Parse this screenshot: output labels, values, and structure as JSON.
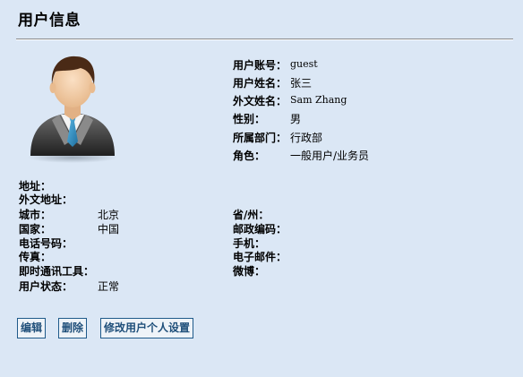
{
  "page": {
    "title": "用户信息"
  },
  "profile": [
    {
      "label": "用户账号：",
      "value": "guest"
    },
    {
      "label": "用户姓名：",
      "value": "张三"
    },
    {
      "label": "外文姓名：",
      "value": "Sam Zhang"
    },
    {
      "label": "性别：",
      "value": "男"
    },
    {
      "label": "所属部门：",
      "value": "行政部"
    },
    {
      "label": "角色：",
      "value": "一般用户/业务员"
    }
  ],
  "details": {
    "address": {
      "label": "地址：",
      "value": ""
    },
    "foreign_address": {
      "label": "外文地址：",
      "value": ""
    },
    "city": {
      "label": "城市：",
      "value": "北京"
    },
    "state": {
      "label": "省/州：",
      "value": ""
    },
    "country": {
      "label": "国家：",
      "value": "中国"
    },
    "postcode": {
      "label": "邮政编码：",
      "value": ""
    },
    "phone": {
      "label": "电话号码：",
      "value": ""
    },
    "mobile": {
      "label": "手机：",
      "value": ""
    },
    "fax": {
      "label": "传真：",
      "value": ""
    },
    "email": {
      "label": "电子邮件：",
      "value": ""
    },
    "im": {
      "label": "即时通讯工具：",
      "value": ""
    },
    "weibo": {
      "label": "微博：",
      "value": ""
    },
    "status": {
      "label": "用户状态：",
      "value": "正常"
    }
  },
  "buttons": {
    "edit": "编辑",
    "delete": "删除",
    "settings": "修改用户个人设置"
  },
  "icons": {
    "avatar": "user-avatar-icon"
  }
}
